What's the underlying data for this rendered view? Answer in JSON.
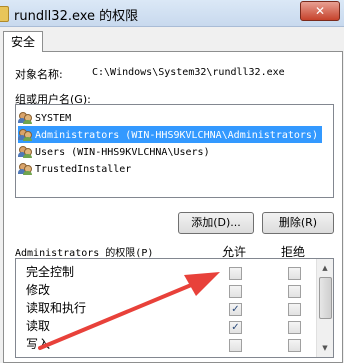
{
  "window": {
    "title": "rundll32.exe 的权限",
    "close_glyph": "✕"
  },
  "tabs": [
    {
      "label": "安全"
    }
  ],
  "object": {
    "label": "对象名称:",
    "value": "C:\\Windows\\System32\\rundll32.exe"
  },
  "groups": {
    "label": "组或用户名(G):",
    "items": [
      {
        "name": "SYSTEM",
        "icon": "users-icon"
      },
      {
        "name": "Administrators (WIN-HHS9KVLCHNA\\Administrators)",
        "icon": "users-icon",
        "selected": true
      },
      {
        "name": "Users (WIN-HHS9KVLCHNA\\Users)",
        "icon": "users-icon"
      },
      {
        "name": "TrustedInstaller",
        "icon": "users-icon"
      }
    ]
  },
  "buttons": {
    "add": "添加(D)...",
    "remove": "删除(R)"
  },
  "permissions": {
    "label": "Administrators 的权限(P)",
    "allow_header": "允许",
    "deny_header": "拒绝",
    "rows": [
      {
        "name": "完全控制",
        "allow": false,
        "deny": false
      },
      {
        "name": "修改",
        "allow": false,
        "deny": false
      },
      {
        "name": "读取和执行",
        "allow": true,
        "deny": false
      },
      {
        "name": "读取",
        "allow": true,
        "deny": false
      },
      {
        "name": "写入",
        "allow": false,
        "deny": false
      }
    ]
  },
  "colors": {
    "selection": "#3399ff",
    "arrow": "#e8413a",
    "check": "#2a4a7a"
  }
}
